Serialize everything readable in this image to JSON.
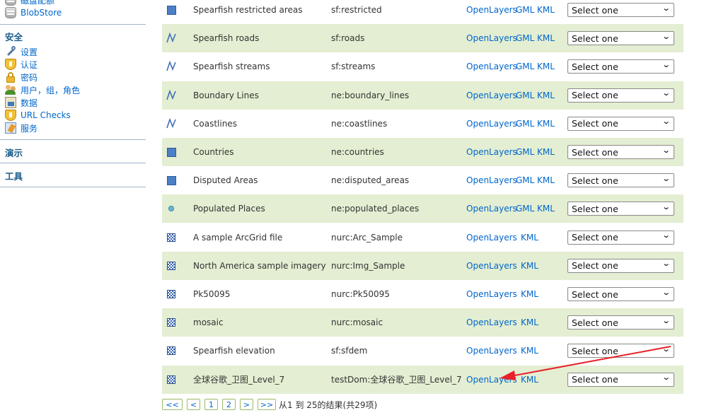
{
  "sidebar": {
    "items_top": [
      {
        "label": "磁盘配额",
        "icon": "disk-quota-icon"
      },
      {
        "label": "BlobStore",
        "icon": "blobstore-icon"
      }
    ],
    "security": {
      "heading": "安全",
      "items": [
        {
          "label": "设置",
          "icon": "wrench-icon"
        },
        {
          "label": "认证",
          "icon": "shield-icon"
        },
        {
          "label": "密码",
          "icon": "lock-icon"
        },
        {
          "label": "用户，组，角色",
          "icon": "users-icon"
        },
        {
          "label": "数据",
          "icon": "data-icon"
        },
        {
          "label": "URL Checks",
          "icon": "shield-icon"
        },
        {
          "label": "服务",
          "icon": "service-icon"
        }
      ]
    },
    "demos_heading": "演示",
    "tools_heading": "工具"
  },
  "table": {
    "link_openlayers": "OpenLayers",
    "link_gml": "GML",
    "link_kml": "KML",
    "select_placeholder": "Select one",
    "rows": [
      {
        "type": "polygon",
        "title": "Spearfish restricted areas",
        "name": "sf:restricted",
        "gml": true
      },
      {
        "type": "line",
        "title": "Spearfish roads",
        "name": "sf:roads",
        "gml": true
      },
      {
        "type": "line",
        "title": "Spearfish streams",
        "name": "sf:streams",
        "gml": true
      },
      {
        "type": "line",
        "title": "Boundary Lines",
        "name": "ne:boundary_lines",
        "gml": true
      },
      {
        "type": "line",
        "title": "Coastlines",
        "name": "ne:coastlines",
        "gml": true
      },
      {
        "type": "polygon",
        "title": "Countries",
        "name": "ne:countries",
        "gml": true
      },
      {
        "type": "polygon",
        "title": "Disputed Areas",
        "name": "ne:disputed_areas",
        "gml": true
      },
      {
        "type": "point",
        "title": "Populated Places",
        "name": "ne:populated_places",
        "gml": true
      },
      {
        "type": "raster",
        "title": "A sample ArcGrid file",
        "name": "nurc:Arc_Sample",
        "gml": false
      },
      {
        "type": "raster",
        "title": "North America sample imagery",
        "name": "nurc:Img_Sample",
        "gml": false
      },
      {
        "type": "raster",
        "title": "Pk50095",
        "name": "nurc:Pk50095",
        "gml": false
      },
      {
        "type": "raster",
        "title": "mosaic",
        "name": "nurc:mosaic",
        "gml": false
      },
      {
        "type": "raster",
        "title": "Spearfish elevation",
        "name": "sf:sfdem",
        "gml": false
      },
      {
        "type": "raster",
        "title": "全球谷歌_卫图_Level_7",
        "name": "testDom:全球谷歌_卫图_Level_7",
        "gml": false
      }
    ]
  },
  "pager": {
    "first": "<<",
    "prev": "<",
    "pages": [
      "1",
      "2"
    ],
    "next": ">",
    "last": ">>",
    "summary": "从1 到 25的结果(共29项)"
  },
  "colors": {
    "link": "#0066cc",
    "row_highlight": "#e3eed2",
    "annotation_arrow": "#e8202a"
  }
}
